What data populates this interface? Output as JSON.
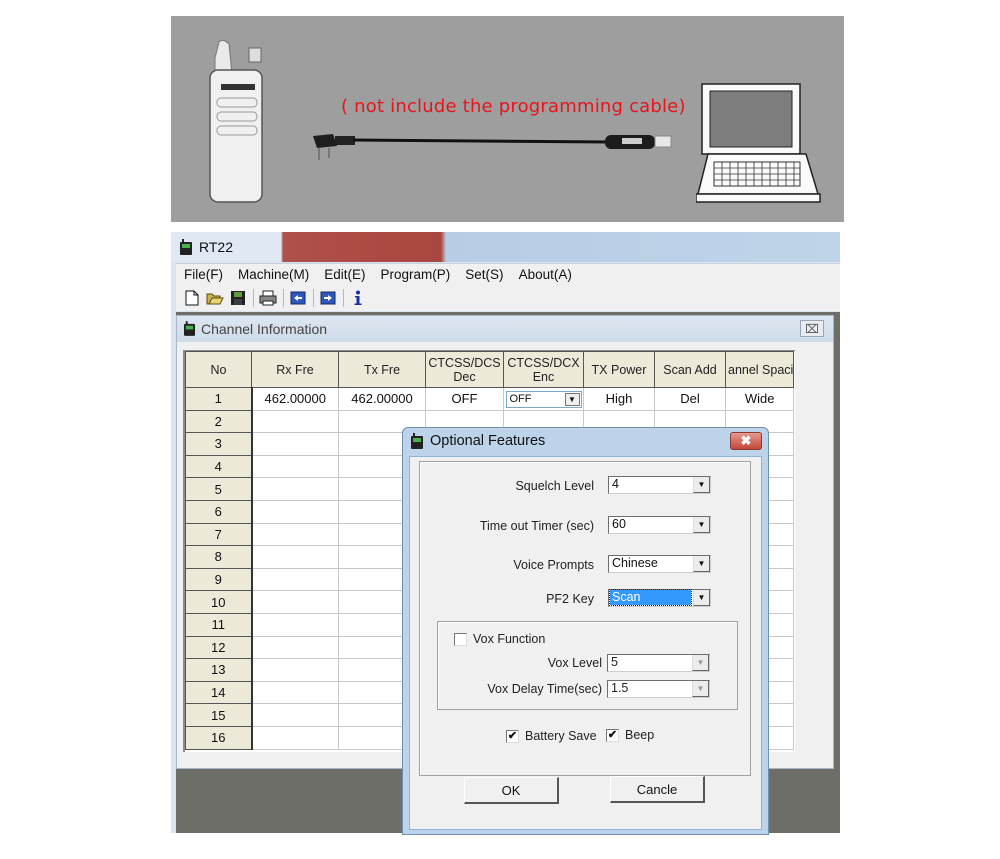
{
  "banner": {
    "caption": "( not include the programming cable)",
    "images": [
      "walkie-talkie-radio",
      "programming-cable",
      "laptop"
    ],
    "caption_color": "#e8141c"
  },
  "app": {
    "title": "RT22",
    "menu": [
      "File(F)",
      "Machine(M)",
      "Edit(E)",
      "Program(P)",
      "Set(S)",
      "About(A)"
    ],
    "toolbar": [
      "new-file-icon",
      "open-folder-icon",
      "save-icon",
      "print-icon",
      "read-from-radio-icon",
      "write-to-radio-icon",
      "info-icon"
    ]
  },
  "channel_window": {
    "title": "Channel Information",
    "close_label": "⌧",
    "columns": [
      "No",
      "Rx Fre",
      "Tx Fre",
      "CTCSS/DCS\nDec",
      "CTCSS/DCX\nEnc",
      "TX Power",
      "Scan Add",
      "annel Spaci"
    ],
    "rows": [
      {
        "no": "1",
        "rx": "462.00000",
        "tx": "462.00000",
        "dec": "OFF",
        "enc": "OFF",
        "power": "High",
        "scan": "Del",
        "spacing": "Wide"
      },
      {
        "no": "2"
      },
      {
        "no": "3"
      },
      {
        "no": "4"
      },
      {
        "no": "5"
      },
      {
        "no": "6"
      },
      {
        "no": "7"
      },
      {
        "no": "8"
      },
      {
        "no": "9"
      },
      {
        "no": "10"
      },
      {
        "no": "11"
      },
      {
        "no": "12"
      },
      {
        "no": "13"
      },
      {
        "no": "14"
      },
      {
        "no": "15"
      },
      {
        "no": "16"
      }
    ]
  },
  "dialog": {
    "title": "Optional Features",
    "close_label": "✖",
    "fields": {
      "squelch_label": "Squelch Level",
      "squelch_value": "4",
      "tot_label": "Time out Timer (sec)",
      "tot_value": "60",
      "voice_label": "Voice Prompts",
      "voice_value": "Chinese",
      "pf2_label": "PF2 Key",
      "pf2_value": "Scan"
    },
    "vox": {
      "function_label": "Vox Function",
      "function_checked": false,
      "level_label": "Vox Level",
      "level_value": "5",
      "delay_label": "Vox Delay Time(sec)",
      "delay_value": "1.5"
    },
    "battery_save_label": "Battery Save",
    "battery_save_checked": true,
    "beep_label": "Beep",
    "beep_checked": true,
    "ok_label": "OK",
    "cancel_label": "Cancle",
    "check_mark": "✔",
    "dropdown_arrow": "▼"
  }
}
